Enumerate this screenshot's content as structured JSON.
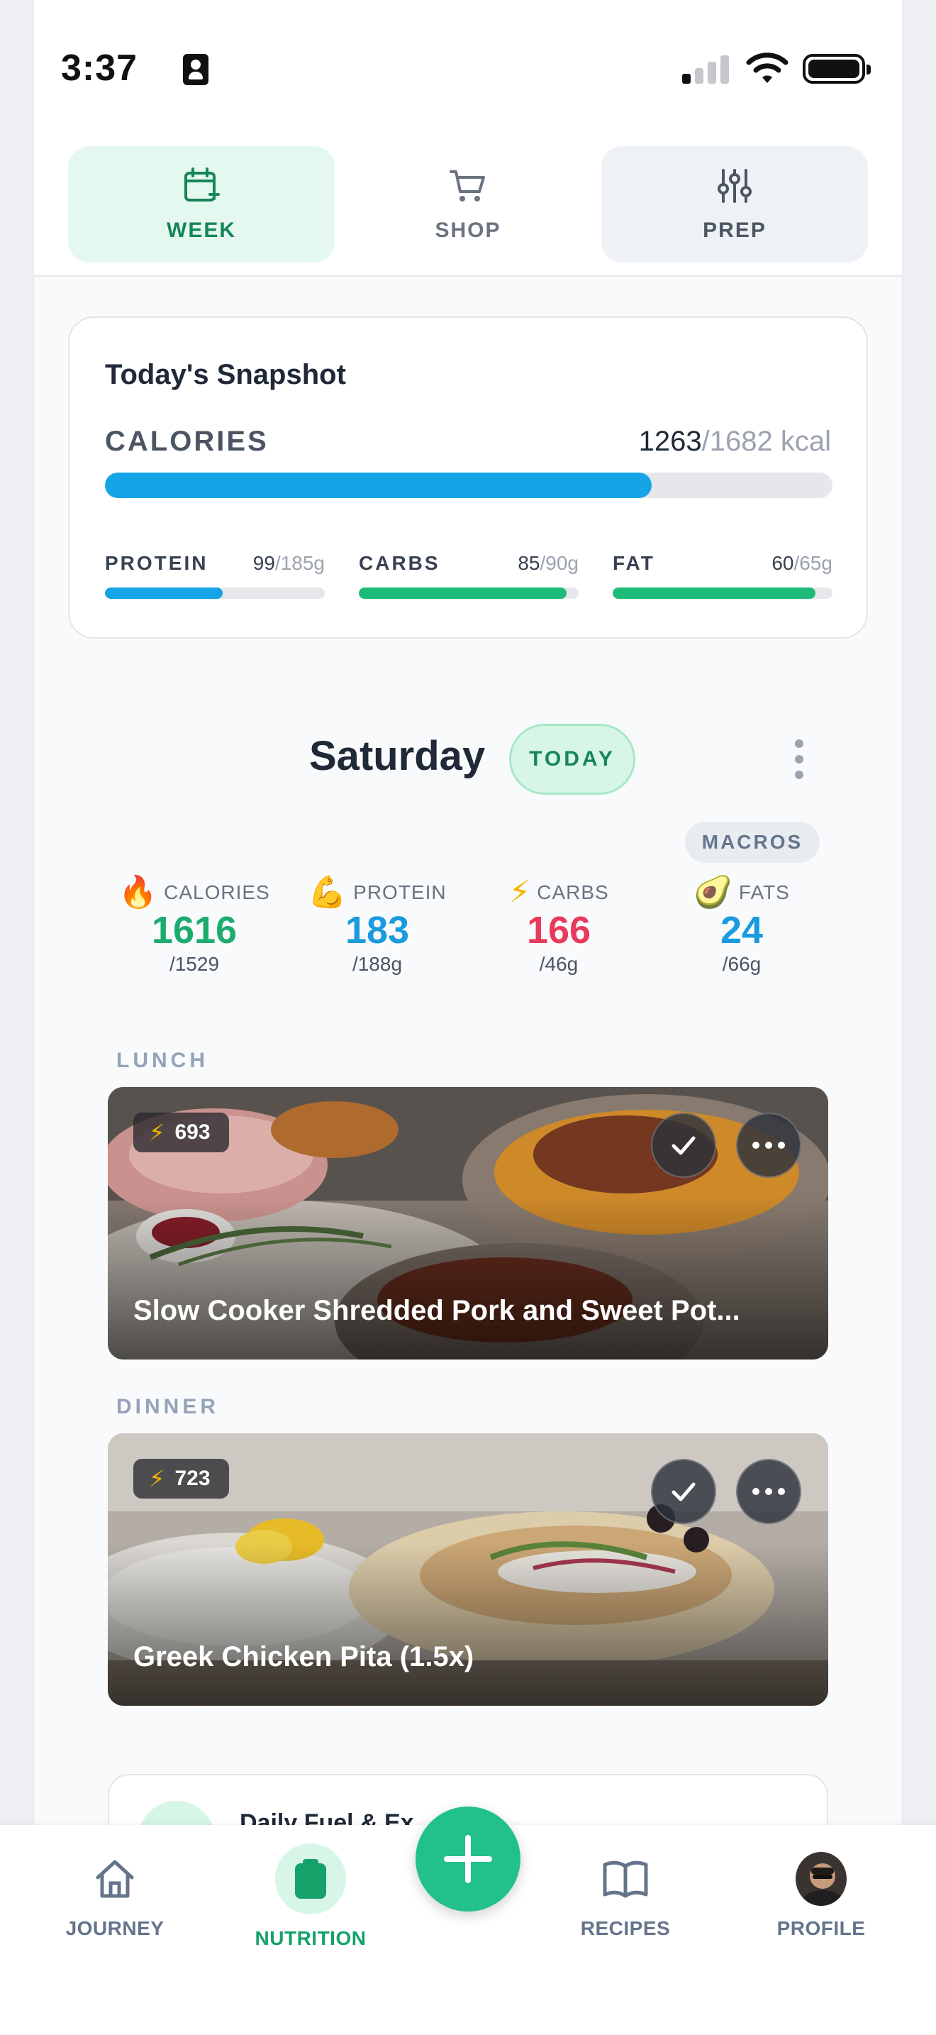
{
  "status_bar": {
    "time": "3:37"
  },
  "tabs": [
    {
      "label": "WEEK",
      "icon": "calendar-icon",
      "active": true
    },
    {
      "label": "SHOP",
      "icon": "cart-icon",
      "active": false
    },
    {
      "label": "PREP",
      "icon": "sliders-icon",
      "active": false
    }
  ],
  "snapshot": {
    "title": "Today's Snapshot",
    "calories": {
      "label": "CALORIES",
      "current": "1263",
      "target": "/1682 kcal",
      "fraction": 0.751
    },
    "macros": [
      {
        "label": "PROTEIN",
        "current": "99",
        "target": "/185g",
        "fraction": 0.535,
        "color": "#15a5e6"
      },
      {
        "label": "CARBS",
        "current": "85",
        "target": "/90g",
        "fraction": 0.944,
        "color": "#1dbb78"
      },
      {
        "label": "FAT",
        "current": "60",
        "target": "/65g",
        "fraction": 0.923,
        "color": "#1dbb78"
      }
    ]
  },
  "day": {
    "title": "Saturday",
    "badge": "TODAY",
    "macros_chip": "MACROS",
    "stats": [
      {
        "emoji": "🔥",
        "label": "CALORIES",
        "value": "1616",
        "target": "/1529",
        "color": "#1dab6f"
      },
      {
        "emoji": "💪",
        "label": "PROTEIN",
        "value": "183",
        "target": "/188g",
        "color": "#1a9be0"
      },
      {
        "emoji": "⚡",
        "label": "CARBS",
        "value": "166",
        "target": "/46g",
        "color": "#e83a5c"
      },
      {
        "emoji": "🥑",
        "label": "FATS",
        "value": "24",
        "target": "/66g",
        "color": "#1a9be0"
      }
    ]
  },
  "meals": [
    {
      "section": "LUNCH",
      "kcal": "693",
      "title": "Slow Cooker Shredded Pork and Sweet Pot..."
    },
    {
      "section": "DINNER",
      "kcal": "723",
      "title": "Greek Chicken Pita (1.5x)"
    }
  ],
  "peek_card": {
    "title": "Daily Fuel & Ex"
  },
  "bottom_nav": [
    {
      "label": "JOURNEY",
      "icon": "home-icon",
      "active": false
    },
    {
      "label": "NUTRITION",
      "icon": "clipboard-icon",
      "active": true
    },
    {
      "label": "RECIPES",
      "icon": "book-icon",
      "active": false
    },
    {
      "label": "PROFILE",
      "icon": "avatar",
      "active": false
    }
  ],
  "colors": {
    "brand_green": "#1dbb78",
    "calorie_blue": "#15a5e6",
    "fab_green": "#22c08a"
  }
}
